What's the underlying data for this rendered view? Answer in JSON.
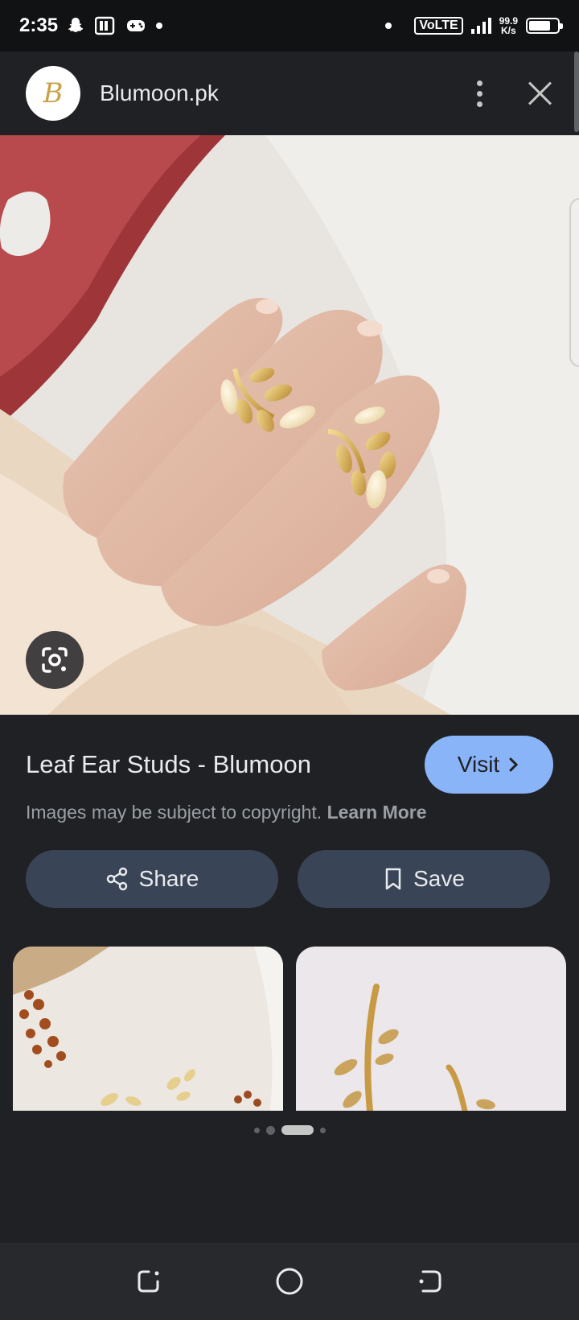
{
  "status_bar": {
    "time": "2:35",
    "network": "VoLTE",
    "speed_value": "99.9",
    "speed_unit": "K/s",
    "battery_level": 0.75
  },
  "header": {
    "logo_letter": "B",
    "site_name": "Blumoon.pk",
    "menu_icon": "more-vert-icon",
    "close_icon": "close-icon"
  },
  "main_image": {
    "subject": "gold leaf ear studs held on fingertips",
    "lens_icon": "lens-search-icon"
  },
  "info": {
    "title": "Leaf Ear Studs - Blumoon",
    "visit_label": "Visit",
    "copyright_text": "Images may be subject to copyright.",
    "learn_more_label": "Learn More"
  },
  "actions": {
    "share_label": "Share",
    "save_label": "Save"
  },
  "pager": {
    "total": 4,
    "active_index": 2
  },
  "colors": {
    "background": "#202124",
    "accent": "#8ab4f8",
    "action_button": "#394457"
  }
}
